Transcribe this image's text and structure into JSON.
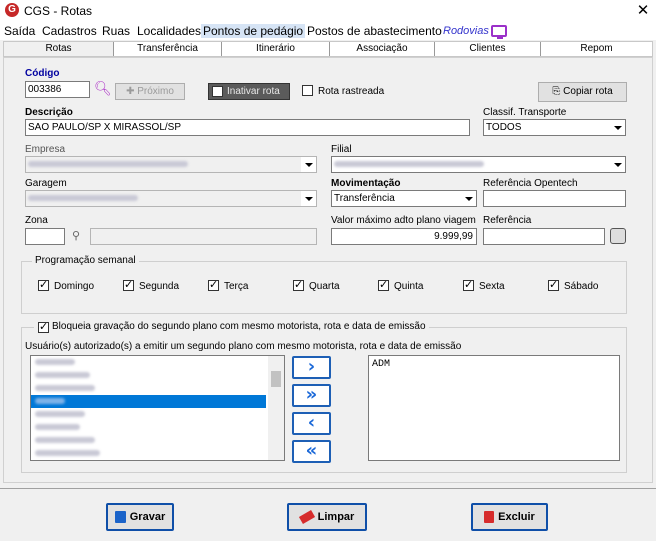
{
  "window": {
    "title": "CGS - Rotas",
    "close_glyph": "✕",
    "app_icon_letter": "G"
  },
  "menu": [
    "Saída",
    "Cadastros",
    "Ruas",
    "Localidades",
    "Pontos de pedágio",
    "Postos de abastecimento"
  ],
  "menu_rodovias": "Rodovias",
  "tabs": [
    "Rotas",
    "Transferência",
    "Itinerário",
    "Associação",
    "Clientes",
    "Repom"
  ],
  "form": {
    "codigo_label": "Código",
    "codigo_value": "003386",
    "proximo_label": "Próximo",
    "inativar_label": "Inativar rota",
    "rastreada_label": "Rota rastreada",
    "copiar_label": "Copiar rota",
    "descricao_label": "Descrição",
    "descricao_value": "SAO PAULO/SP X MIRASSOL/SP",
    "classif_label": "Classif. Transporte",
    "classif_value": "TODOS",
    "empresa_label": "Empresa",
    "filial_label": "Filial",
    "garagem_label": "Garagem",
    "movimentacao_label": "Movimentação",
    "movimentacao_value": "Transferência",
    "ref_opentech_label": "Referência Opentech",
    "zona_label": "Zona",
    "valor_label": "Valor máximo adto plano viagem",
    "valor_value": "9.999,99",
    "referencia_label": "Referência"
  },
  "programacao": {
    "title": "Programação semanal",
    "days": [
      "Domingo",
      "Segunda",
      "Terça",
      "Quarta",
      "Quinta",
      "Sexta",
      "Sábado"
    ]
  },
  "bloqueia": {
    "label": "Bloqueia gravação do segundo plano com mesmo motorista, rota e data de emissão",
    "usuarios_label": "Usuário(s) autorizado(s) a emitir um segundo plano com mesmo motorista, rota e data de emissão",
    "selected_users": [
      "ADM"
    ],
    "move_buttons": [
      "›",
      "»",
      "‹",
      "«"
    ]
  },
  "buttons": {
    "gravar": "Gravar",
    "limpar": "Limpar",
    "excluir": "Excluir"
  },
  "colors": {
    "accent_blue": "#0f4fa8",
    "selection": "#0078d7",
    "rodovias": "#3333cc"
  }
}
